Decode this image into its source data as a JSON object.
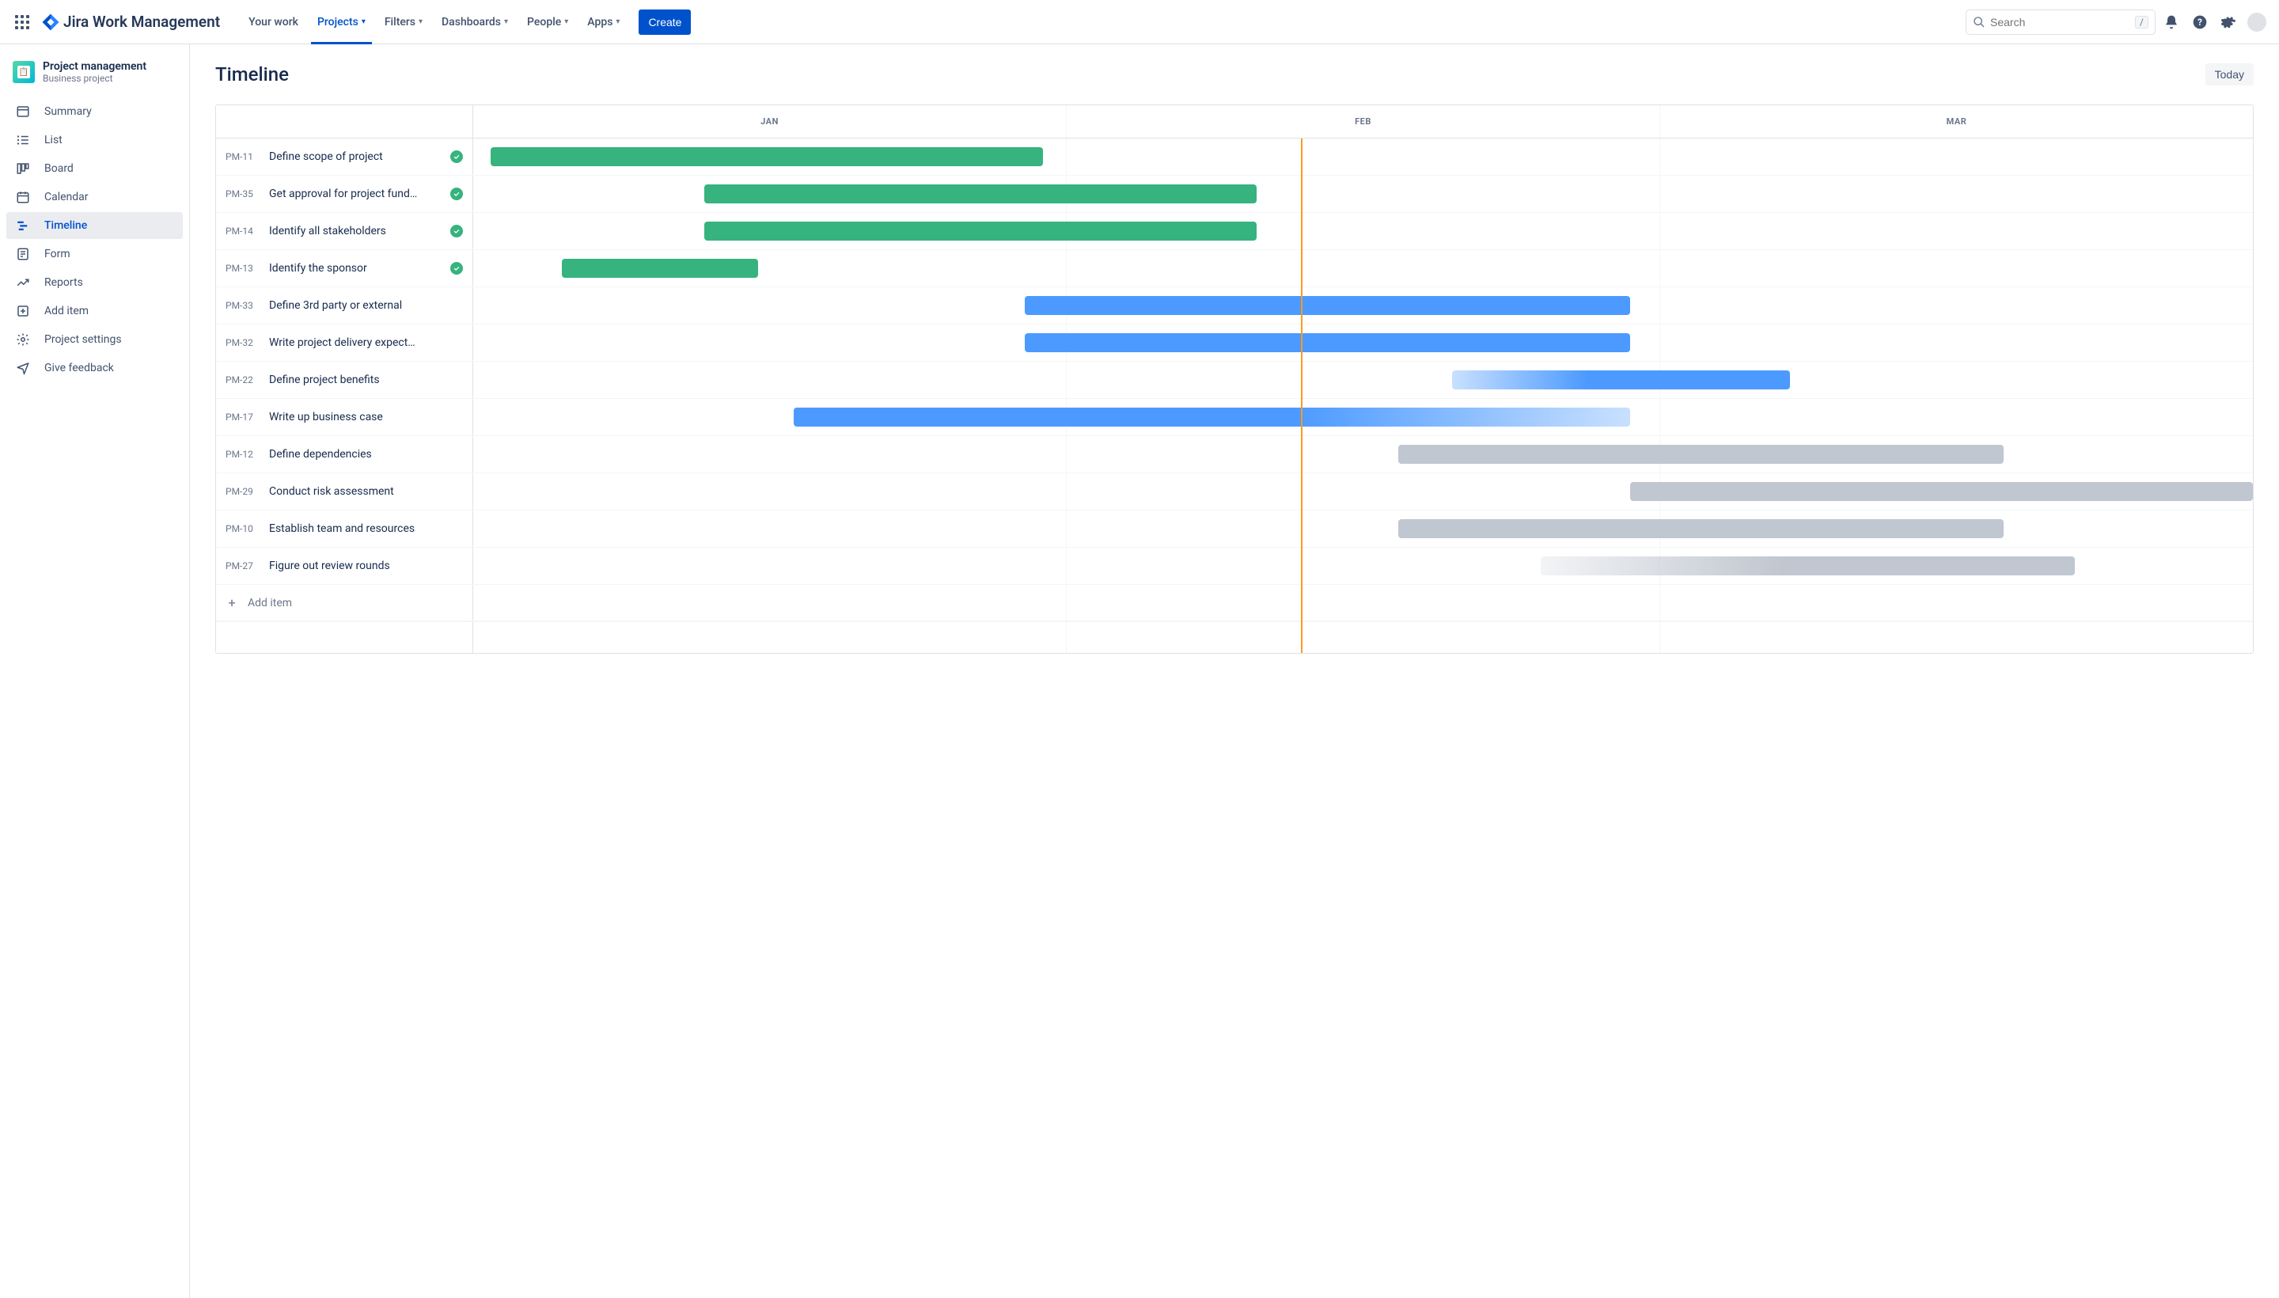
{
  "brand": "Jira Work Management",
  "nav": {
    "your_work": "Your work",
    "projects": "Projects",
    "filters": "Filters",
    "dashboards": "Dashboards",
    "people": "People",
    "apps": "Apps",
    "create": "Create"
  },
  "search": {
    "placeholder": "Search",
    "slash": "/"
  },
  "project": {
    "name": "Project management",
    "type": "Business project"
  },
  "sidebar": {
    "items": [
      {
        "label": "Summary"
      },
      {
        "label": "List"
      },
      {
        "label": "Board"
      },
      {
        "label": "Calendar"
      },
      {
        "label": "Timeline"
      },
      {
        "label": "Form"
      },
      {
        "label": "Reports"
      },
      {
        "label": "Add item"
      },
      {
        "label": "Project settings"
      },
      {
        "label": "Give feedback"
      }
    ]
  },
  "page": {
    "title": "Timeline",
    "today": "Today",
    "add_item": "Add item"
  },
  "months": [
    "JAN",
    "FEB",
    "MAR"
  ],
  "today_position_pct": 46.5,
  "tasks": [
    {
      "id": "PM-11",
      "title": "Define scope of project",
      "done": true,
      "color": "green",
      "start_pct": 1,
      "width_pct": 31
    },
    {
      "id": "PM-35",
      "title": "Get approval for project fund…",
      "done": true,
      "color": "green",
      "start_pct": 13,
      "width_pct": 31
    },
    {
      "id": "PM-14",
      "title": "Identify all stakeholders",
      "done": true,
      "color": "green",
      "start_pct": 13,
      "width_pct": 31
    },
    {
      "id": "PM-13",
      "title": "Identify the sponsor",
      "done": true,
      "color": "green",
      "start_pct": 5,
      "width_pct": 11
    },
    {
      "id": "PM-33",
      "title": "Define 3rd party or external",
      "done": false,
      "color": "blue",
      "start_pct": 31,
      "width_pct": 34
    },
    {
      "id": "PM-32",
      "title": "Write project delivery expect…",
      "done": false,
      "color": "blue",
      "start_pct": 31,
      "width_pct": 34
    },
    {
      "id": "PM-22",
      "title": "Define project benefits",
      "done": false,
      "color": "gradient-blue",
      "start_pct": 55,
      "width_pct": 19
    },
    {
      "id": "PM-17",
      "title": "Write up business case",
      "done": false,
      "color": "gradient-blue-rev",
      "start_pct": 18,
      "width_pct": 47
    },
    {
      "id": "PM-12",
      "title": "Define dependencies",
      "done": false,
      "color": "gray",
      "start_pct": 52,
      "width_pct": 34
    },
    {
      "id": "PM-29",
      "title": "Conduct risk assessment",
      "done": false,
      "color": "gray",
      "start_pct": 65,
      "width_pct": 35
    },
    {
      "id": "PM-10",
      "title": "Establish team and resources",
      "done": false,
      "color": "gray",
      "start_pct": 52,
      "width_pct": 34
    },
    {
      "id": "PM-27",
      "title": "Figure out review rounds",
      "done": false,
      "color": "gradient-gray",
      "start_pct": 60,
      "width_pct": 30
    }
  ]
}
